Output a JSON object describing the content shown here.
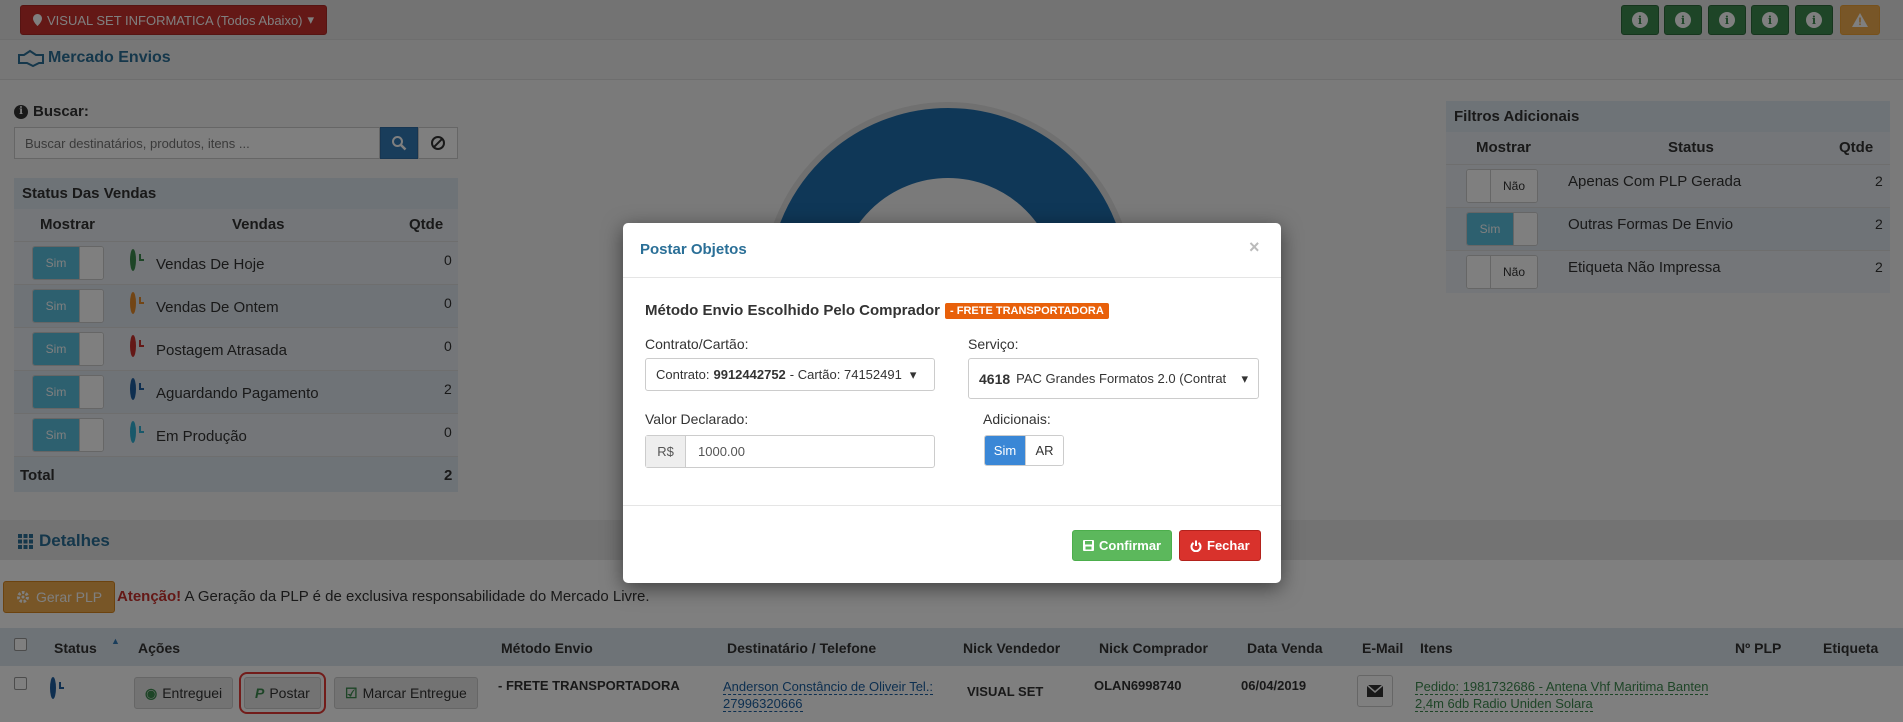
{
  "topbar": {
    "company_label": "VISUAL SET INFORMATICA (Todos Abaixo)",
    "info_buttons": [
      "info-icon",
      "info-icon",
      "info-icon",
      "info-icon",
      "info-icon"
    ],
    "warning_icon": "warning-icon"
  },
  "breadcrumb": {
    "title": "Mercado Envios"
  },
  "search": {
    "label": "Buscar:",
    "placeholder": "Buscar destinatários, produtos, itens ..."
  },
  "status_panel": {
    "title": "Status Das Vendas",
    "headers": {
      "show": "Mostrar",
      "sales": "Vendas",
      "qty": "Qtde"
    },
    "rows": [
      {
        "toggle": "Sim",
        "label": "Vendas De Hoje",
        "qty": "0",
        "color": "#3c8a4e"
      },
      {
        "toggle": "Sim",
        "label": "Vendas De Ontem",
        "qty": "0",
        "color": "#e58a2a"
      },
      {
        "toggle": "Sim",
        "label": "Postagem Atrasada",
        "qty": "0",
        "color": "#c9302c"
      },
      {
        "toggle": "Sim",
        "label": "Aguardando Pagamento",
        "qty": "2",
        "color": "#1f5fa0"
      },
      {
        "toggle": "Sim",
        "label": "Em Produção",
        "qty": "0",
        "color": "#31b0d5"
      }
    ],
    "total_label": "Total",
    "total_value": "2"
  },
  "filters_panel": {
    "title": "Filtros Adicionais",
    "headers": {
      "show": "Mostrar",
      "status": "Status",
      "qty": "Qtde"
    },
    "rows": [
      {
        "toggle": "Não",
        "label": "Apenas Com PLP Gerada",
        "qty": "2"
      },
      {
        "toggle": "Sim",
        "label": "Outras Formas De Envio",
        "qty": "2"
      },
      {
        "toggle": "Não",
        "label": "Etiqueta Não Impressa",
        "qty": "2"
      }
    ]
  },
  "modal": {
    "title": "Postar Objetos",
    "close": "×",
    "method_label": "Método Envio Escolhido Pelo Comprador",
    "method_badge": "- FRETE TRANSPORTADORA",
    "contract_label": "Contrato/Cartão:",
    "contract_prefix": "Contrato:",
    "contract_number": "9912442752",
    "card_text": "- Cartão: 74152491",
    "service_label": "Serviço:",
    "service_code": "4618",
    "service_name": "PAC Grandes Formatos 2.0 (Contrat",
    "value_label": "Valor Declarado:",
    "currency": "R$",
    "value": "1000.00",
    "extras_label": "Adicionais:",
    "extra_on": "Sim",
    "extra_ar": "AR",
    "confirm": "Confirmar",
    "close_button": "Fechar"
  },
  "details": {
    "title": "Detalhes",
    "gerar_plp": "Gerar PLP",
    "attention": "Atenção!",
    "attention_text": "A Geração da PLP é de exclusiva responsabilidade do Mercado Livre.",
    "columns": [
      "Status",
      "Ações",
      "Método Envio",
      "Destinatário / Telefone",
      "Nick Vendedor",
      "Nick Comprador",
      "Data Venda",
      "E-Mail",
      "Itens",
      "Nº PLP",
      "Etiqueta"
    ],
    "row": {
      "btn_entreguei": "Entreguei",
      "btn_postar": "Postar",
      "btn_marcar": "Marcar Entregue",
      "method": "- FRETE TRANSPORTADORA",
      "recipient_line1": "Anderson Constâncio de Oliveir Tel.:",
      "recipient_line2": "27996320666",
      "seller": "VISUAL SET",
      "buyer": "OLAN6998740",
      "date": "06/04/2019",
      "item_line1": "Pedido: 1981732686 - Antena Vhf Maritima Banten",
      "item_line2": "2,4m 6db Radio Uniden Solara"
    }
  }
}
